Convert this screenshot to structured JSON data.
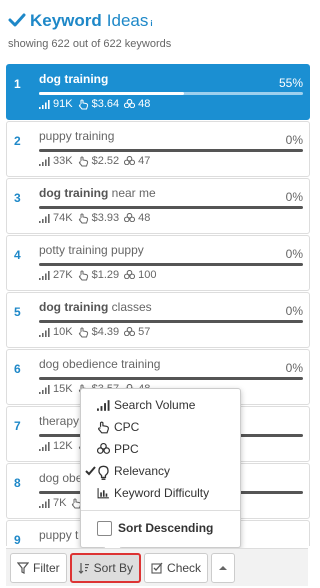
{
  "header": {
    "title_strong": "Keyword",
    "title_light": "Ideas",
    "title_sup": "i",
    "subtitle": "showing 622 out of 622 keywords"
  },
  "colors": {
    "accent": "#1b8fd2",
    "highlight": "#d33333"
  },
  "rows": [
    {
      "rank": "1",
      "kw_bold": "dog training",
      "kw_rest": "",
      "pct": "55%",
      "fill": 0.55,
      "volume": "91K",
      "cpc": "$3.64",
      "ppc": "48",
      "selected": true
    },
    {
      "rank": "2",
      "kw_bold": "",
      "kw_rest": "puppy training",
      "pct": "0%",
      "fill": 0,
      "volume": "33K",
      "cpc": "$2.52",
      "ppc": "47",
      "selected": false
    },
    {
      "rank": "3",
      "kw_bold": "dog training",
      "kw_rest": " near me",
      "pct": "0%",
      "fill": 0,
      "volume": "74K",
      "cpc": "$3.93",
      "ppc": "48",
      "selected": false
    },
    {
      "rank": "4",
      "kw_bold": "",
      "kw_rest": "potty training puppy",
      "pct": "0%",
      "fill": 0,
      "volume": "27K",
      "cpc": "$1.29",
      "ppc": "100",
      "selected": false
    },
    {
      "rank": "5",
      "kw_bold": "dog training",
      "kw_rest": " classes",
      "pct": "0%",
      "fill": 0,
      "volume": "10K",
      "cpc": "$4.39",
      "ppc": "57",
      "selected": false
    },
    {
      "rank": "6",
      "kw_bold": "",
      "kw_rest": "dog obedience training",
      "pct": "0%",
      "fill": 0,
      "volume": "15K",
      "cpc": "$3.57",
      "ppc": "48",
      "selected": false
    },
    {
      "rank": "7",
      "kw_bold": "",
      "kw_rest": "therapy",
      "pct": "",
      "fill": 0,
      "volume": "12K",
      "cpc": "",
      "ppc": "",
      "selected": false
    },
    {
      "rank": "8",
      "kw_bold": "",
      "kw_rest": "dog obe",
      "pct": "",
      "fill": 0,
      "volume": "7K",
      "cpc": "",
      "ppc": "",
      "selected": false
    },
    {
      "rank": "9",
      "kw_bold": "",
      "kw_rest": "puppy t",
      "pct": "",
      "fill": 0,
      "volume": "",
      "cpc": "",
      "ppc": "",
      "selected": false
    }
  ],
  "sort_menu": {
    "items": [
      {
        "label": "Search Volume",
        "icon": "signal-bars-icon",
        "checked": false
      },
      {
        "label": "CPC",
        "icon": "hand-pointer-icon",
        "checked": false
      },
      {
        "label": "PPC",
        "icon": "cubes-icon",
        "checked": false
      },
      {
        "label": "Relevancy",
        "icon": "lightbulb-icon",
        "checked": true
      },
      {
        "label": "Keyword Difficulty",
        "icon": "bar-chart-icon",
        "checked": false
      }
    ],
    "descending_label": "Sort Descending"
  },
  "toolbar": {
    "filter_label": "Filter",
    "sort_label": "Sort By",
    "check_label": "Check"
  }
}
